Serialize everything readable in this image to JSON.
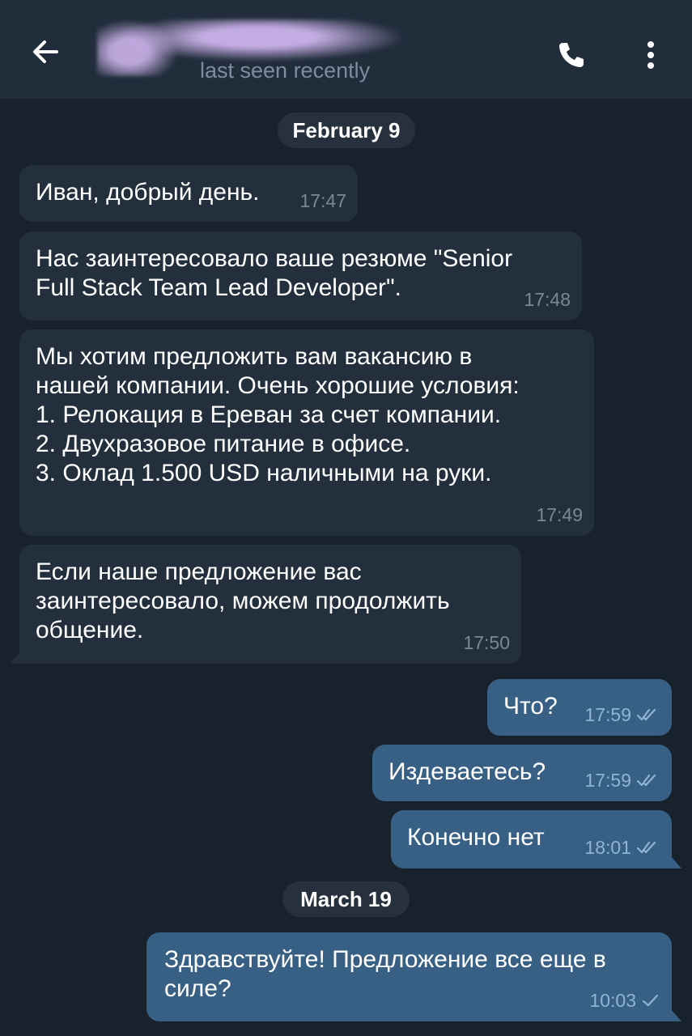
{
  "header": {
    "status": "last seen recently"
  },
  "dates": [
    "February 9",
    "March 19"
  ],
  "messages": [
    {
      "text": "Иван, добрый день.",
      "time": "17:47"
    },
    {
      "text": "Нас заинтересовало ваше резюме \"Senior\nFull Stack Team Lead Developer\".",
      "time": "17:48"
    },
    {
      "text": "Мы хотим предложить вам вакансию в\nнашей компании. Очень хорошие условия:\n1. Релокация в Ереван за счет компании.\n2. Двухразовое питание в офисе.\n3. Оклад 1.500 USD наличными на руки.",
      "time": "17:49"
    },
    {
      "text": "Если наше предложение вас\nзаинтересовало, можем продолжить\nобщение.",
      "time": "17:50"
    },
    {
      "text": "Что?",
      "time": "17:59",
      "status": "read"
    },
    {
      "text": "Издеваетесь?",
      "time": "17:59",
      "status": "read"
    },
    {
      "text": "Конечно нет",
      "time": "18:01",
      "status": "read"
    },
    {
      "text": "Здравствуйте! Предложение все еще в\nсиле?",
      "time": "10:03",
      "status": "sent"
    }
  ],
  "icons": {
    "back": "arrow-left-icon",
    "call": "phone-icon",
    "menu": "more-vertical-icon",
    "read": "double-check-icon",
    "sent": "check-icon"
  },
  "colors": {
    "background": "#18222d",
    "header": "#212d3b",
    "incoming_bubble": "#232f3c",
    "outgoing_bubble": "#386085",
    "secondary_text": "#7e8c9c"
  }
}
